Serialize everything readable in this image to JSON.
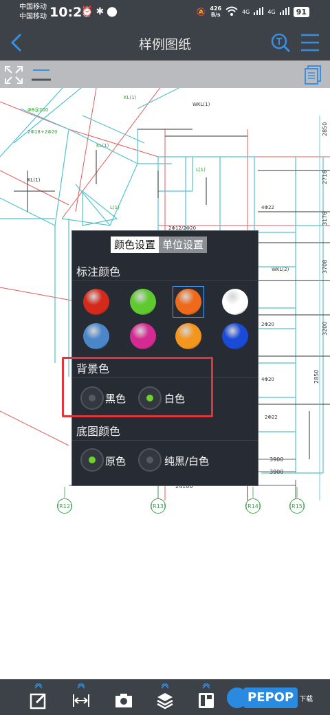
{
  "status": {
    "carrier1": "中国移动",
    "carrier2": "中国移动",
    "time": "10:26",
    "net_speed_value": "426",
    "net_speed_unit": "B/s",
    "network_type": "4G",
    "battery": "91"
  },
  "header": {
    "title": "样例图纸"
  },
  "panel": {
    "tabs": [
      {
        "label": "颜色设置",
        "active": true
      },
      {
        "label": "单位设置",
        "active": false
      }
    ],
    "annotation_color": {
      "title": "标注颜色",
      "swatches": [
        {
          "color": "#d42a1c",
          "selected": false
        },
        {
          "color": "#5fc930",
          "selected": false
        },
        {
          "color": "#ef6a1a",
          "selected": true
        },
        {
          "color": "#ffffff",
          "selected": false
        },
        {
          "color": "#4a86c8",
          "selected": false
        },
        {
          "color": "#d42a92",
          "selected": false
        },
        {
          "color": "#f3961e",
          "selected": false
        },
        {
          "color": "#1a4ad8",
          "selected": false
        }
      ]
    },
    "background_color": {
      "title": "背景色",
      "options": [
        {
          "label": "黑色",
          "selected": false
        },
        {
          "label": "白色",
          "selected": true
        }
      ]
    },
    "base_color": {
      "title": "底图颜色",
      "options": [
        {
          "label": "原色",
          "selected": true
        },
        {
          "label": "纯黑/白色",
          "selected": false
        }
      ]
    }
  },
  "drawing": {
    "dimensions_right": [
      "2850",
      "2716",
      "3176",
      "3708",
      "3200",
      "2850"
    ],
    "dimensions_bottom": [
      "3900",
      "3900"
    ],
    "top_dimension": "5631",
    "bottom_dimension": "24100",
    "axis_labels": [
      "(R12)",
      "(R13)",
      "(R14)",
      "(R15)"
    ]
  },
  "watermark": {
    "text": "PEPOP",
    "sub": "下载"
  }
}
